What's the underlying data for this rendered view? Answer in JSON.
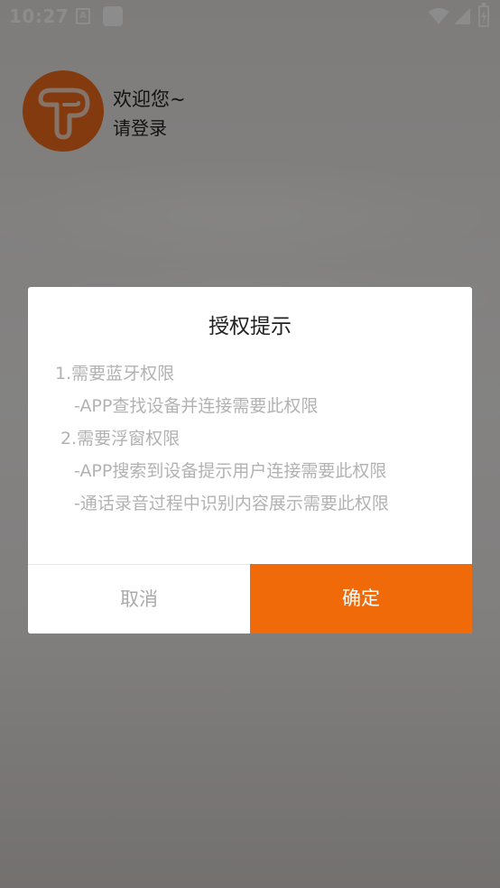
{
  "status_bar": {
    "time": "10:27",
    "notification_letter": "A",
    "icons": [
      "a-notification-icon",
      "square-notification-icon",
      "wifi-icon",
      "signal-icon",
      "battery-charging-icon"
    ]
  },
  "profile": {
    "greeting": "欢迎您~",
    "login_prompt": "请登录",
    "avatar_icon": "t-logo-icon",
    "brand_color": "#ef6a1a"
  },
  "dialog": {
    "title": "授权提示",
    "lines": [
      "1.需要蓝牙权限",
      "-APP查找设备并连接需要此权限",
      "2.需要浮窗权限",
      "-APP搜索到设备提示用户连接需要此权限",
      "-通话录音过程中识别内容展示需要此权限"
    ],
    "cancel_label": "取消",
    "confirm_label": "确定",
    "confirm_color": "#f06a09"
  }
}
